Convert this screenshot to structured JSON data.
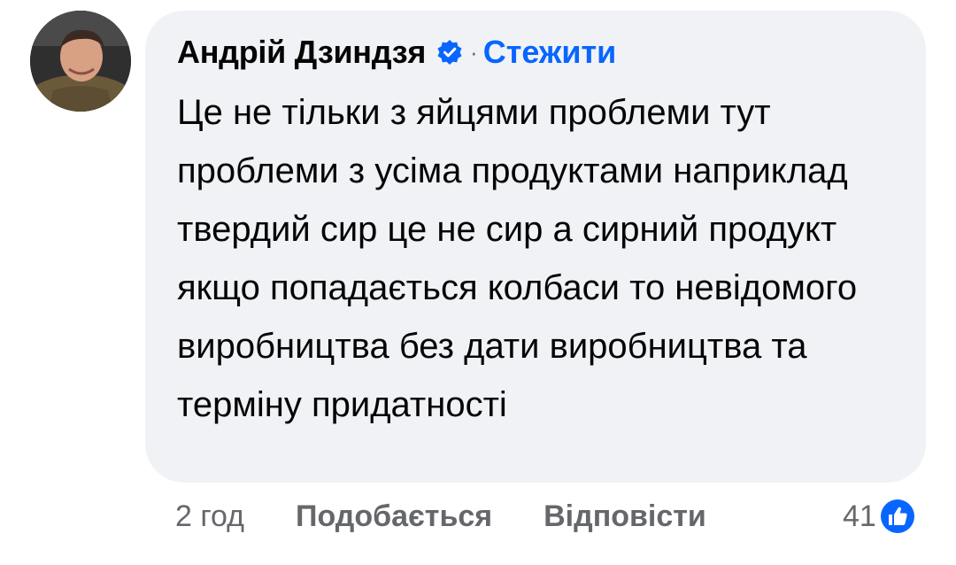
{
  "comment": {
    "author": "Андрій Дзиндзя",
    "verified": true,
    "separator": "·",
    "follow_label": "Стежити",
    "text": "Це не тільки з яйцями проблеми тут проблеми з усіма продуктами наприклад твердий сир це не сир а сирний продукт якщо попадається колбаси то невідомого виробництва без дати виробництва та терміну придатності"
  },
  "footer": {
    "time": "2 год",
    "like_label": "Подобається",
    "reply_label": "Відповісти",
    "reaction_count": "41"
  },
  "colors": {
    "bubble": "#f0f2f5",
    "link_blue": "#0866ff",
    "secondary_text": "#65676b"
  },
  "icons": {
    "verified": "verified-badge-icon",
    "reaction": "like-reaction-icon"
  }
}
